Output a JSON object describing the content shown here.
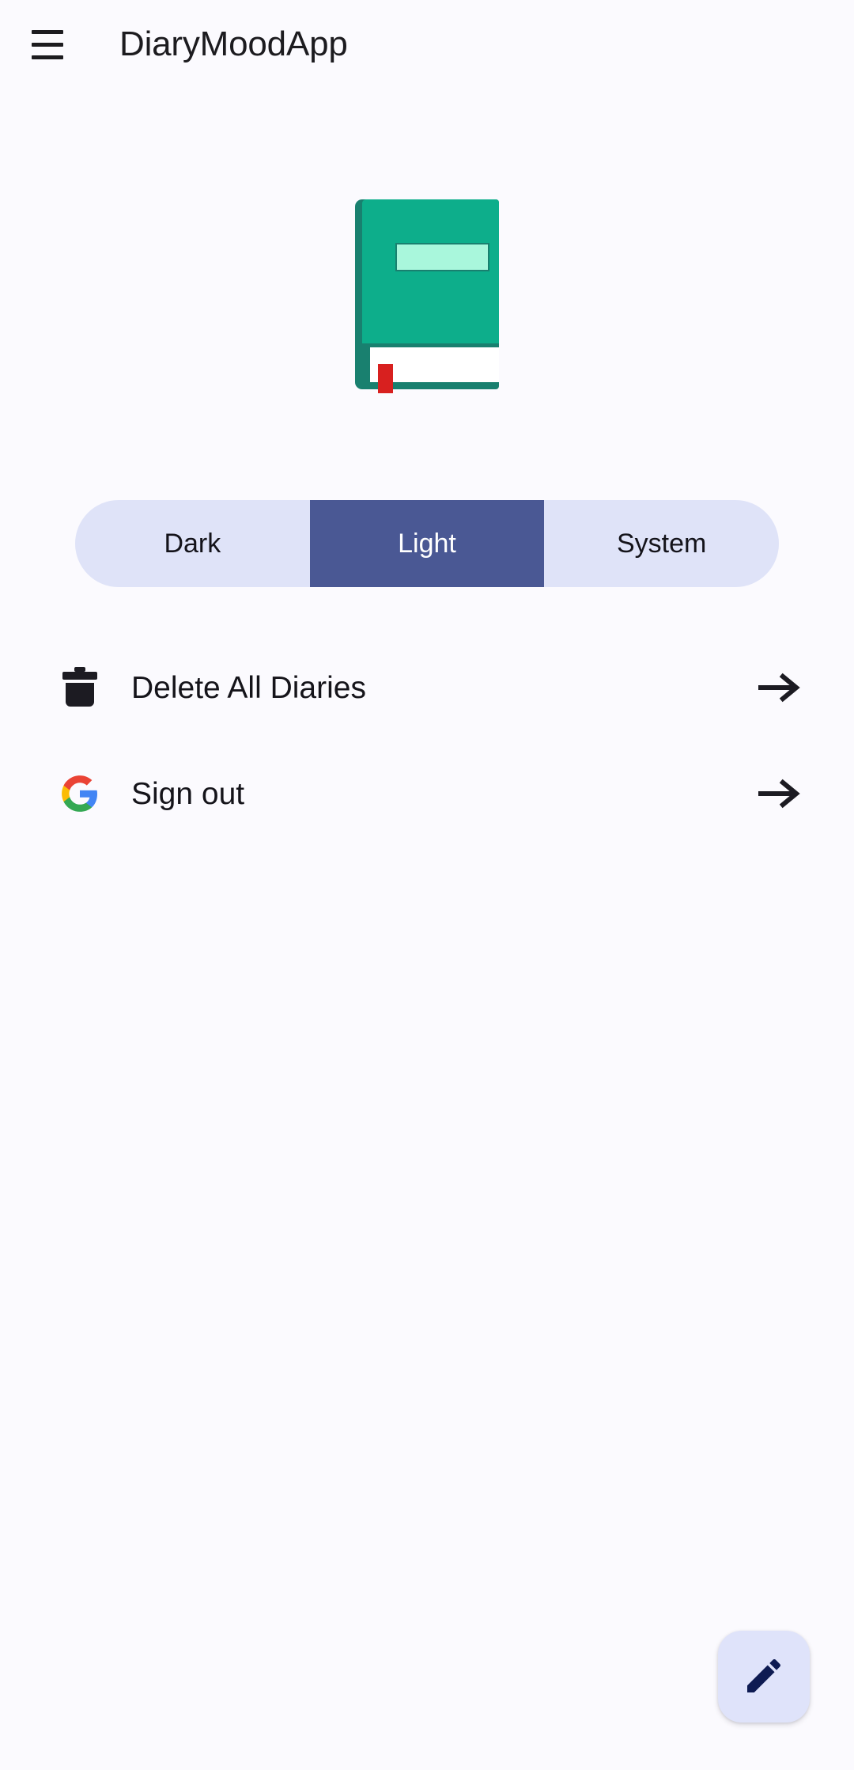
{
  "app": {
    "background_color": "#FBFAFE",
    "title": "DiaryMoodApp",
    "menu_icon": "hamburger-menu-icon"
  },
  "hero": {
    "illustration": "green-book-emoji",
    "cover_color": "#0DAE8B",
    "spine_color": "#19806F",
    "label_color": "#A9F7DC",
    "pages_color": "#FFFFFF",
    "ribbon_color": "#D8201F"
  },
  "theme_selector": {
    "name": "theme-mode-segmented-control",
    "selected": "Light",
    "track_color": "#DFE3F8",
    "selected_color": "#4A5894",
    "selected_text_color": "#FFFFFF",
    "options": [
      {
        "label": "Dark",
        "value": "dark",
        "selected": false
      },
      {
        "label": "Light",
        "value": "light",
        "selected": true
      },
      {
        "label": "System",
        "value": "system",
        "selected": false
      }
    ]
  },
  "actions": [
    {
      "label": "Delete All Diaries",
      "icon": "trash-icon",
      "trailing_icon": "arrow-right-icon"
    },
    {
      "label": "Sign out",
      "icon": "google-logo-icon",
      "trailing_icon": "arrow-right-icon"
    }
  ],
  "fab": {
    "name": "new-diary-fab",
    "icon": "pencil-edit-icon",
    "background_color": "#DFE3FA",
    "icon_color": "#0E1B52"
  }
}
